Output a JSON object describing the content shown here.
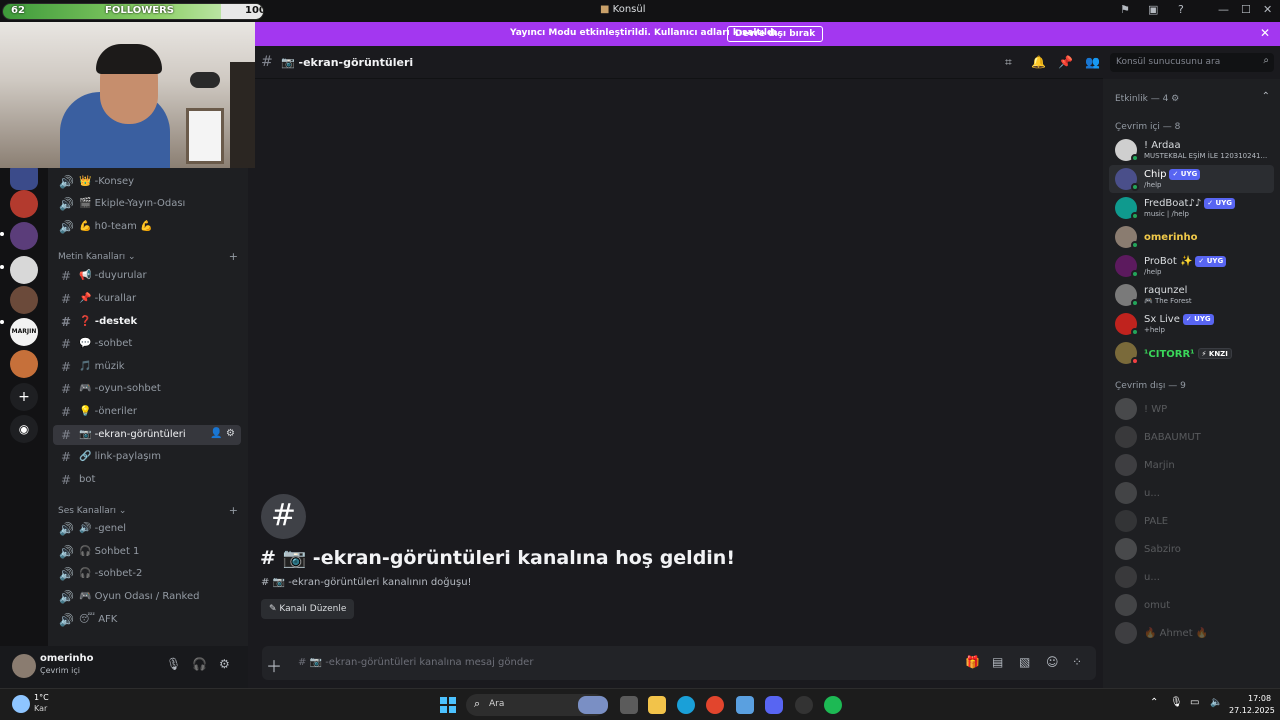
{
  "followers": {
    "current": "62",
    "label": "FOLLOWERS",
    "goal": "100"
  },
  "window": {
    "title": "Konsül"
  },
  "banner": {
    "text": "Yayıncı Modu etkinleştirildi. Kullanıcı adları kısaltıldı.",
    "button": "Devre dışı bırak"
  },
  "sidebar": {
    "voice_top": [
      {
        "label": "👑 -Konsey"
      },
      {
        "label": "🎬 Ekiple-Yayın-Odası"
      },
      {
        "label": "💪 h0-team 💪"
      }
    ],
    "text_category": "Metin Kanalları",
    "text_channels": [
      {
        "label": "📢 -duyurular"
      },
      {
        "label": "📌 -kurallar"
      },
      {
        "label": "❓ -destek"
      },
      {
        "label": "💬 -sohbet"
      },
      {
        "label": "🎵 müzik"
      },
      {
        "label": "🎮 -oyun-sohbet"
      },
      {
        "label": "💡 -öneriler"
      },
      {
        "label": "📷 -ekran-görüntüleri"
      },
      {
        "label": "🔗 link-paylaşım"
      },
      {
        "label": "bot"
      }
    ],
    "voice_category": "Ses Kanalları",
    "voice_channels": [
      {
        "label": "🔊 -genel"
      },
      {
        "label": "Sohbet 1"
      },
      {
        "label": "-sohbet-2"
      },
      {
        "label": "🎮 Oyun Odası / Ranked"
      },
      {
        "label": "😴 AFK"
      }
    ]
  },
  "user": {
    "name": "omerinho",
    "status": "Çevrim içi"
  },
  "channel": {
    "name": "📷 -ekran-görüntüleri",
    "search_placeholder": "Konsül sunucusunu ara",
    "welcome_title": "# 📷 -ekran-görüntüleri kanalına hoş geldin!",
    "welcome_sub": "# 📷 -ekran-görüntüleri kanalının doğuşu!",
    "edit_button": "Kanalı Düzenle",
    "composer_placeholder": "# 📷 -ekran-görüntüleri kanalına mesaj gönder"
  },
  "members": {
    "activity_header": "Etkinlik — 4",
    "online_header": "Çevrim içi — 8",
    "offline_header": "Çevrim dışı — 9",
    "online": [
      {
        "name": "! Ardaa",
        "sub": "MUSTEKBAL EŞİM İLE 120310241...",
        "badge": ""
      },
      {
        "name": "Chip",
        "sub": "/help",
        "badge": "✓ UYG"
      },
      {
        "name": "FredBoat♪♪",
        "sub": "music | /help",
        "badge": "✓ UYG"
      },
      {
        "name": "omerinho",
        "sub": "",
        "badge": ""
      },
      {
        "name": "ProBot ✨",
        "sub": "/help",
        "badge": "✓ UYG"
      },
      {
        "name": "raqunzel",
        "sub": "🎮 The Forest",
        "badge": ""
      },
      {
        "name": "Sx Live",
        "sub": "+help",
        "badge": "✓ UYG"
      },
      {
        "name": "¹CITORR¹",
        "sub": "",
        "badge": "⚡ KNZI"
      }
    ],
    "offline": [
      {
        "name": "! WP"
      },
      {
        "name": "BABAUMUT"
      },
      {
        "name": "Marjin"
      },
      {
        "name": "u..."
      },
      {
        "name": "PALE"
      },
      {
        "name": "Sabziro"
      },
      {
        "name": "u..."
      },
      {
        "name": "omut"
      },
      {
        "name": "🔥 Ahmet 🔥"
      }
    ]
  },
  "taskbar": {
    "weather_temp": "1°C",
    "weather_cond": "Kar",
    "search_placeholder": "Ara",
    "time": "17:08",
    "date": "27.12.2025"
  },
  "colors": {
    "banner": "#a337f0",
    "accent": "#5865f2",
    "online": "#23a55a"
  }
}
